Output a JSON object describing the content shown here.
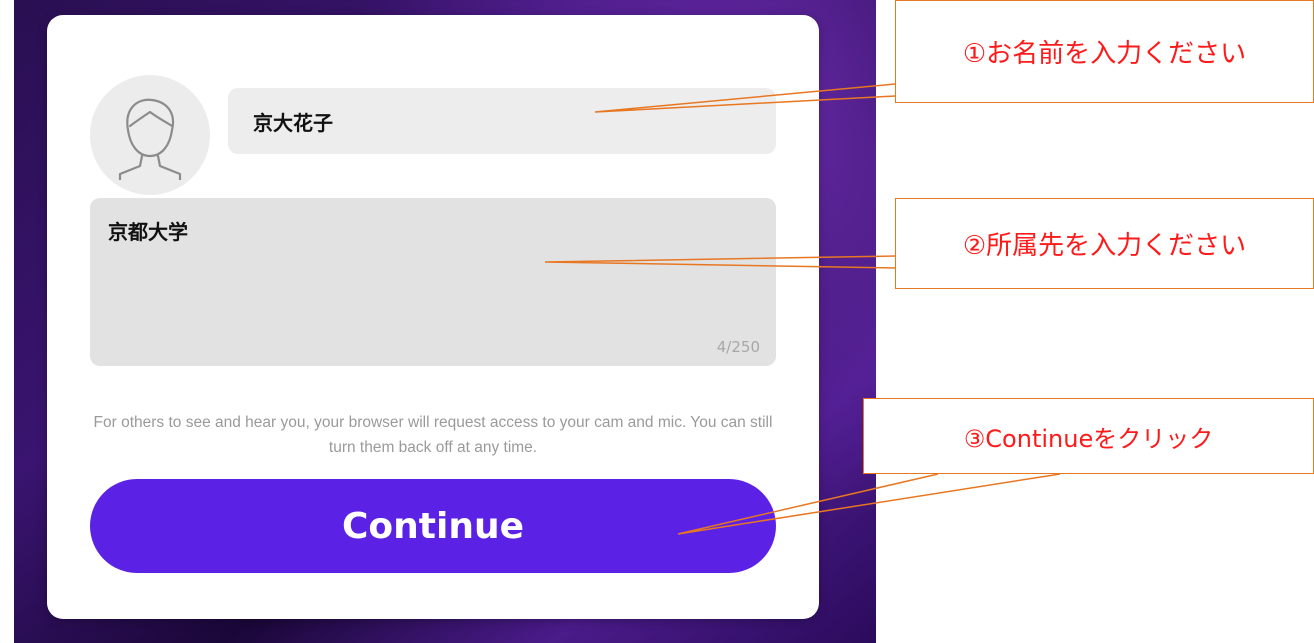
{
  "form": {
    "name_value": "京大花子",
    "affiliation_value": "京都大学",
    "char_counter": "4/250",
    "notice": "For others to see and hear you, your browser will request access to your cam and mic. You can still turn them back off at any time.",
    "continue_label": "Continue",
    "avatar_icon": "user-avatar-icon"
  },
  "annotations": {
    "step1": "①お名前を入力ください",
    "step2": "②所属先を入力ください",
    "step3": "③Continueをクリック"
  },
  "colors": {
    "button": "#5b22e6",
    "callout_border": "#e87722",
    "callout_text": "#ff1a1a"
  }
}
